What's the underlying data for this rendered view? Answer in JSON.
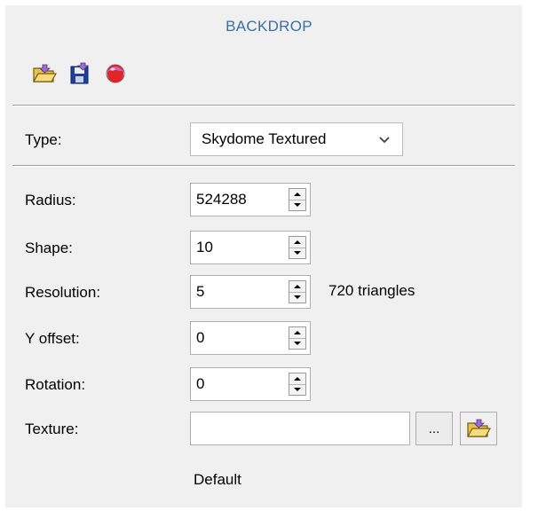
{
  "panel": {
    "title": "BACKDROP",
    "toolbar": [
      {
        "icon": "open-folder-icon"
      },
      {
        "icon": "save-icon"
      },
      {
        "icon": "color-sphere-icon"
      }
    ],
    "colors": {
      "title": "#3a6ea5",
      "background": "#f0f0f0"
    }
  },
  "type": {
    "label": "Type:",
    "value": "Skydome Textured",
    "icon": "chevron-down-icon"
  },
  "fields": {
    "radius": {
      "label": "Radius:",
      "value": "524288"
    },
    "shape": {
      "label": "Shape:",
      "value": "10"
    },
    "resolution": {
      "label": "Resolution:",
      "value": "5",
      "note": "720 triangles"
    },
    "y_offset": {
      "label": "Y offset:",
      "value": "0"
    },
    "rotation": {
      "label": "Rotation:",
      "value": "0"
    }
  },
  "texture": {
    "label": "Texture:",
    "value": "",
    "browse_label": "...",
    "open_icon": "open-folder-icon"
  },
  "footer": {
    "default_label": "Default"
  }
}
